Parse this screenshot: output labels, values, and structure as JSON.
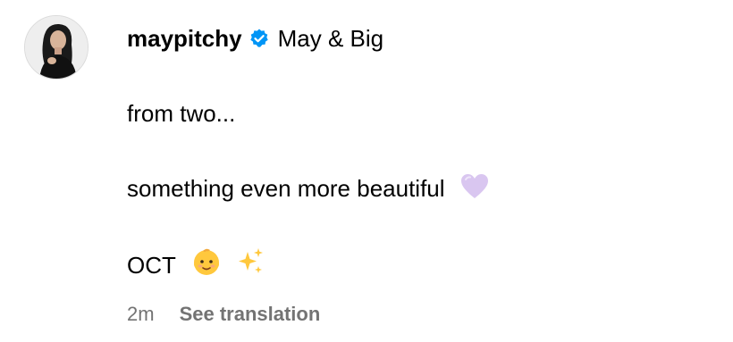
{
  "post": {
    "username": "maypitchy",
    "verified": true,
    "display_name": "May & Big",
    "caption_lines": [
      "from two...",
      "something even more beautiful",
      "OCT"
    ],
    "emojis": {
      "line2": "purple-heart-icon",
      "line3": [
        "baby-icon",
        "sparkles-icon"
      ]
    },
    "timestamp": "2m",
    "see_translation": "See translation"
  },
  "colors": {
    "text": "#000000",
    "meta": "#737373",
    "verified_badge": "#0095f6",
    "heart": "#d9c6f0"
  }
}
